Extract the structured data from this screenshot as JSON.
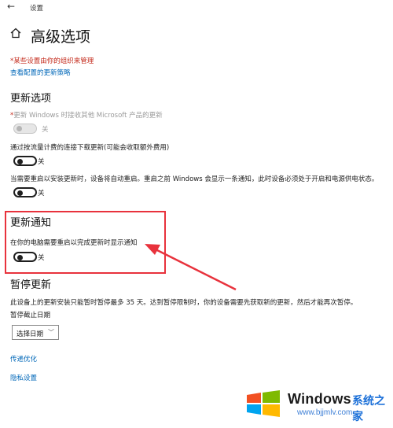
{
  "titlebar": {
    "back_glyph": "←",
    "app_title": "设置"
  },
  "page": {
    "title": "高级选项"
  },
  "org": {
    "warning": "*某些设置由你的组织来管理",
    "policy_link": "查看配置的更新策略"
  },
  "update_options": {
    "heading": "更新选项",
    "items": [
      {
        "asterisk": "*",
        "description": "更新 Windows 时接收其他 Microsoft 产品的更新",
        "toggle_state": "关",
        "disabled": true
      },
      {
        "description": "通过按流量计费的连接下载更新(可能会收取额外费用)",
        "toggle_state": "关",
        "disabled": false
      },
      {
        "description": "当需要重启以安装更新时，设备将自动重启。重启之前 Windows 会显示一条通知，此时设备必须处于开启和电源供电状态。",
        "toggle_state": "关",
        "disabled": false
      }
    ]
  },
  "update_notify": {
    "heading": "更新通知",
    "description": "在你的电脑需要重启以完成更新时显示通知",
    "toggle_state": "关",
    "highlight_color": "#e8323c"
  },
  "pause": {
    "heading": "暂停更新",
    "description": "此设备上的更新安装只能暂时暂停最多 35 天。达到暂停限制时，你的设备需要先获取新的更新，然后才能再次暂停。",
    "until_label": "暂停截止日期",
    "select_value": "选择日期",
    "select_chevron": "﹀"
  },
  "links": {
    "delivery": "传递优化",
    "privacy": "隐私设置"
  },
  "watermark": {
    "brand": "Windows",
    "cn": "系统之家",
    "url": "www.bjjmlv.com"
  },
  "colors": {
    "link": "#0067b8",
    "warning": "#c42b1c",
    "arrow": "#e8323c"
  },
  "icons": {
    "back": "back-arrow-icon",
    "home": "home-icon",
    "chevron": "chevron-down-icon",
    "logo": "windows-logo-icon"
  }
}
